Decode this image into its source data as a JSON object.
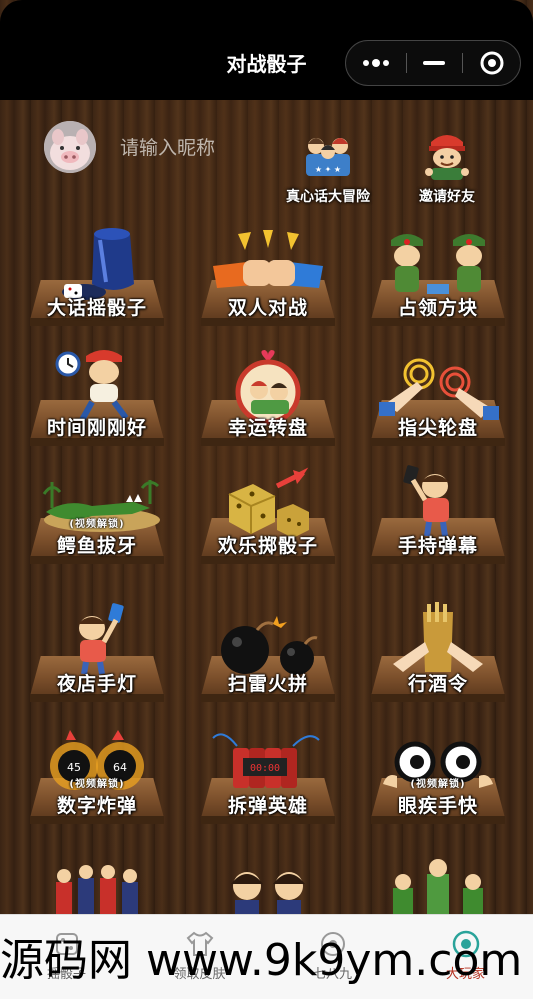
{
  "nav": {
    "title": "对战骰子"
  },
  "profile": {
    "nickname_placeholder": "请输入昵称"
  },
  "quick_links": [
    {
      "label": "真心话大冒险"
    },
    {
      "label": "邀请好友"
    }
  ],
  "games": [
    {
      "label": "大话摇骰子",
      "locked": false
    },
    {
      "label": "双人对战",
      "locked": false
    },
    {
      "label": "占领方块",
      "locked": false
    },
    {
      "label": "时间刚刚好",
      "locked": false
    },
    {
      "label": "幸运转盘",
      "locked": false
    },
    {
      "label": "指尖轮盘",
      "locked": false
    },
    {
      "label": "鳄鱼拔牙",
      "locked": true,
      "badge": "(视频解锁)"
    },
    {
      "label": "欢乐掷骰子",
      "locked": false
    },
    {
      "label": "手持弹幕",
      "locked": false
    },
    {
      "label": "夜店手灯",
      "locked": false
    },
    {
      "label": "扫雷火拼",
      "locked": false
    },
    {
      "label": "行酒令",
      "locked": false
    },
    {
      "label": "数字炸弹",
      "locked": true,
      "badge": "(视频解锁)"
    },
    {
      "label": "拆弹英雄",
      "locked": false
    },
    {
      "label": "眼疾手快",
      "locked": true,
      "badge": "(视频解锁)"
    }
  ],
  "tabs": [
    {
      "label": "摇骰子",
      "active": false
    },
    {
      "label": "领取皮肤",
      "active": false
    },
    {
      "label": "七八九",
      "active": false
    },
    {
      "label": "大玩家",
      "active": true
    }
  ],
  "watermark": "源码网 www.9k9ym.com",
  "colors": {
    "accent": "#b5301f",
    "wood": "#3b2415",
    "nav": "#000000"
  }
}
